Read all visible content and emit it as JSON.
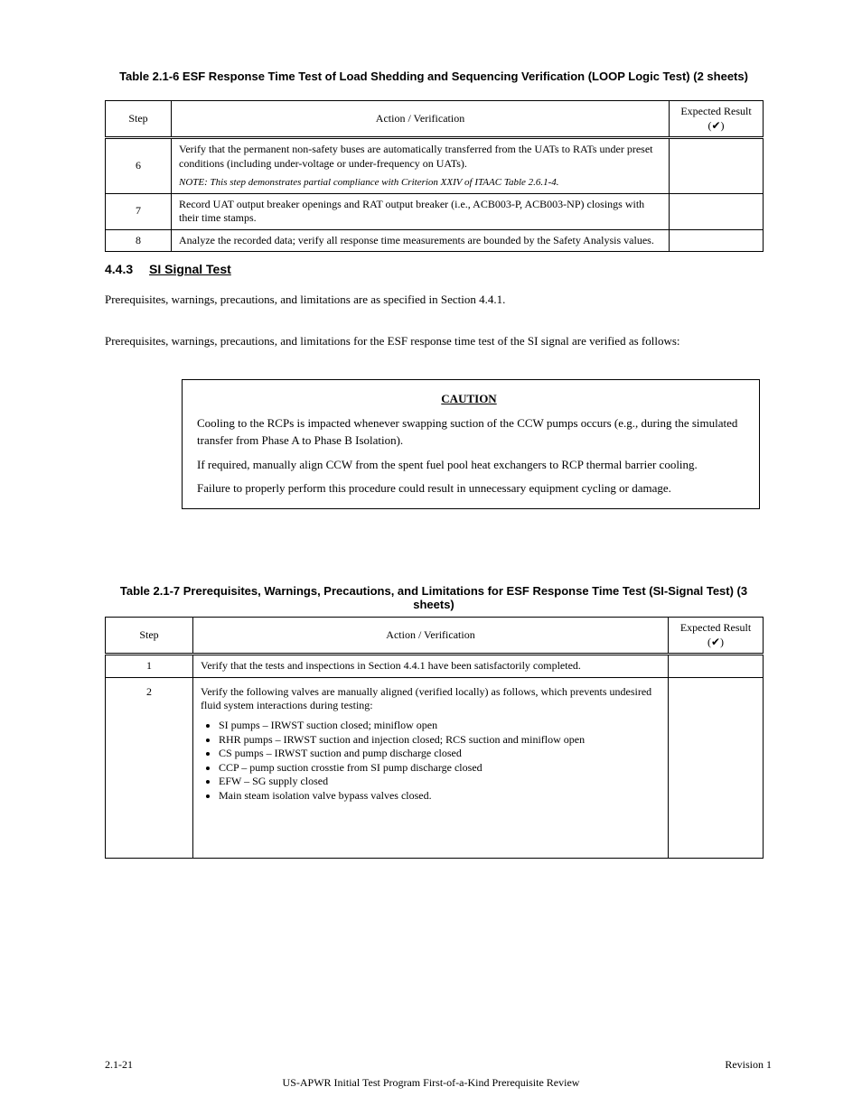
{
  "table1": {
    "caption_top": "Table 2.1-6  ESF Response Time Test of Load Shedding and Sequencing Verification (LOOP Logic Test) (2 sheets)",
    "headers": {
      "step": "Step",
      "action": "Action / Verification",
      "result": "Expected Result (✔)"
    },
    "rows": [
      {
        "step": "6",
        "action": "Verify that the permanent non-safety buses are automatically transferred from the UATs to RATs under preset conditions (including under-voltage or under-frequency on UATs).",
        "note": "NOTE:  This step demonstrates partial compliance with Criterion XXIV of ITAAC Table 2.6.1-4.",
        "result": ""
      },
      {
        "step": "7",
        "action": "Record UAT output breaker openings and RAT output breaker (i.e., ACB003-P, ACB003-NP) closings with their time stamps.",
        "result": ""
      },
      {
        "step": "8",
        "action": "Analyze the recorded data; verify all response time measurements are bounded by the Safety Analysis values.",
        "result": ""
      }
    ]
  },
  "section": {
    "number": "4.4.3",
    "title": "SI Signal Test"
  },
  "pwarn1": "Prerequisites, warnings, precautions, and limitations are as specified in Section 4.4.1.",
  "pwarn2": "Prerequisites, warnings, precautions, and limitations for the ESF response time test of the SI signal are verified as follows:",
  "callout": {
    "lead": "CAUTION",
    "lines": [
      "Cooling to the RCPs is impacted whenever swapping suction of the CCW pumps occurs (e.g., during the simulated transfer from Phase A to Phase B Isolation).",
      "If required, manually align CCW from the spent fuel pool heat exchangers to RCP thermal barrier cooling.",
      "Failure to properly perform this procedure could result in unnecessary equipment cycling or damage."
    ]
  },
  "table2": {
    "caption": "Table 2.1-7  Prerequisites, Warnings, Precautions, and Limitations for ESF Response Time Test (SI-Signal Test) (3 sheets)",
    "headers": {
      "step": "Step",
      "action": "Action / Verification",
      "result": "Expected Result (✔)"
    },
    "rows": [
      {
        "step": "1",
        "action": "Verify that the tests and inspections in Section 4.4.1 have been satisfactorily completed.",
        "result": ""
      },
      {
        "step": "2",
        "action_intro": "Verify the following valves are manually aligned (verified locally) as follows, which prevents undesired fluid system interactions during testing:",
        "bullets": [
          "SI pumps – IRWST suction closed; miniflow open",
          "RHR pumps – IRWST suction and injection closed; RCS suction and miniflow open",
          "CS pumps – IRWST suction and pump discharge closed",
          "CCP – pump suction crosstie from SI pump discharge closed",
          "EFW – SG supply closed",
          "Main steam isolation valve bypass valves closed."
        ],
        "result": ""
      }
    ]
  },
  "footer": {
    "page_label": "2.1-21",
    "rev_label": "Revision 1",
    "doc_title": "US-APWR Initial Test Program First-of-a-Kind Prerequisite Review"
  }
}
